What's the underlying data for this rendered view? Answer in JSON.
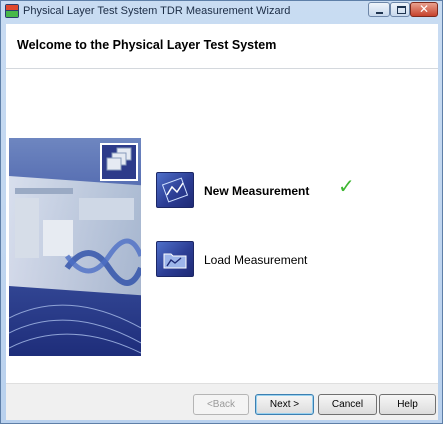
{
  "window": {
    "title": "Physical Layer Test System TDR Measurement Wizard"
  },
  "header": {
    "title": "Welcome to the Physical Layer Test System"
  },
  "options": [
    {
      "label": "New Measurement",
      "selected": true,
      "icon": "new-measurement-icon"
    },
    {
      "label": "Load Measurement",
      "selected": false,
      "icon": "load-measurement-icon"
    }
  ],
  "status": {
    "check": "✓"
  },
  "footer": {
    "back_label": "<Back",
    "next_label": "Next >",
    "cancel_label": "Cancel",
    "help_label": "Help"
  },
  "colors": {
    "accent_check": "#3db631",
    "icon_blue": "#2c3d94"
  }
}
